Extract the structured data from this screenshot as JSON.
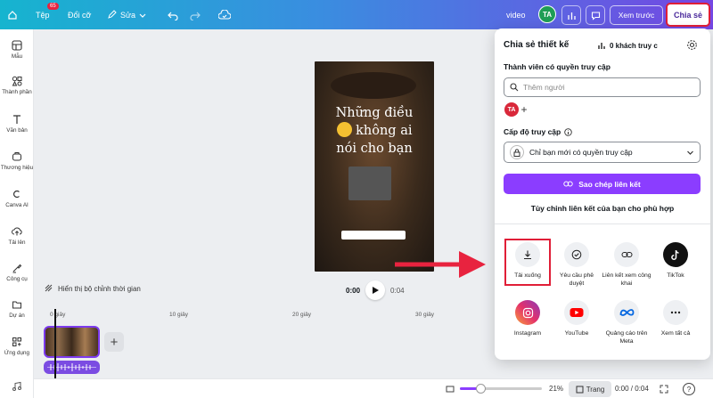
{
  "topbar": {
    "file_label": "Tệp",
    "file_badge": "65",
    "resize_label": "Đổi cỡ",
    "edit_label": "Sửa",
    "doc_type": "video",
    "avatar_initials": "TA",
    "preview_label": "Xem trước",
    "share_label": "Chia sẻ"
  },
  "sidebar": {
    "items": [
      {
        "label": "Mẫu",
        "icon": "template-icon"
      },
      {
        "label": "Thành phần",
        "icon": "elements-icon"
      },
      {
        "label": "Văn bản",
        "icon": "text-icon"
      },
      {
        "label": "Thương hiệu",
        "icon": "brand-icon"
      },
      {
        "label": "Canva AI",
        "icon": "canva-ai-icon"
      },
      {
        "label": "Tải lên",
        "icon": "upload-icon"
      },
      {
        "label": "Công cụ",
        "icon": "tools-icon"
      },
      {
        "label": "Dự án",
        "icon": "folder-icon"
      },
      {
        "label": "Ứng dụng",
        "icon": "apps-icon"
      }
    ]
  },
  "design": {
    "headline_1": "Những điều",
    "headline_2": "không ai",
    "headline_3": "nói cho bạn"
  },
  "timeline": {
    "show_timing": "Hiển thị bộ chỉnh thời gian",
    "current_time": "0:00",
    "duration": "0:04",
    "ruler": [
      "0 giây",
      "10 giây",
      "20 giây",
      "30 giây"
    ]
  },
  "bottombar": {
    "zoom": "21%",
    "pages_label": "Trang",
    "time": "0:00 / 0:04"
  },
  "share_panel": {
    "title": "Chia sẻ thiết kế",
    "visitors": "0 khách truy c",
    "members_label": "Thành viên có quyền truy cập",
    "search_placeholder": "Thêm người",
    "member_initials": "TA",
    "access_label": "Cấp độ truy cập",
    "access_value": "Chỉ bạn mới có quyền truy cập",
    "copy_link": "Sao chép liên kết",
    "customize_link": "Tùy chỉnh liên kết của bạn cho phù hợp",
    "options": [
      {
        "label": "Tải xuống",
        "icon": "download-icon"
      },
      {
        "label": "Yêu cầu phê duyệt",
        "icon": "approval-icon"
      },
      {
        "label": "Liên kết xem công khai",
        "icon": "link-icon"
      },
      {
        "label": "TikTok",
        "icon": "tiktok-icon"
      },
      {
        "label": "Instagram",
        "icon": "instagram-icon"
      },
      {
        "label": "YouTube",
        "icon": "youtube-icon"
      },
      {
        "label": "Quảng cáo trên Meta",
        "icon": "meta-icon"
      },
      {
        "label": "Xem tất cả",
        "icon": "more-icon"
      }
    ]
  },
  "colors": {
    "accent": "#8b3dff",
    "highlight": "#e01e37"
  }
}
